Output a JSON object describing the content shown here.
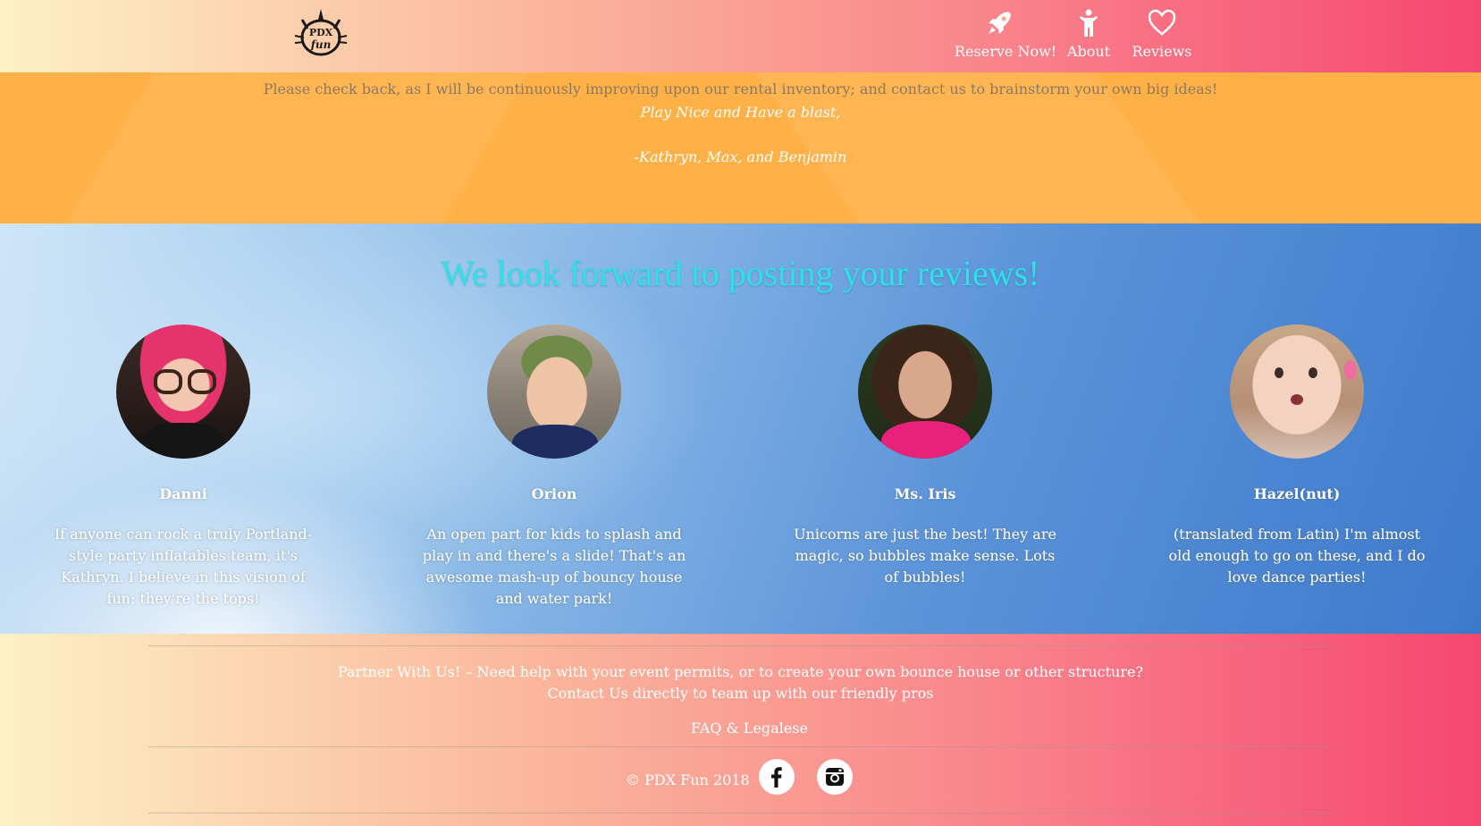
{
  "header": {
    "logo_text": "PDX Fun",
    "nav": [
      {
        "label": "Reserve Now!",
        "icon": "rocket-icon"
      },
      {
        "label": "About",
        "icon": "person-icon"
      },
      {
        "label": "Reviews",
        "icon": "heart-icon"
      }
    ]
  },
  "message": {
    "main": "Please check back, as I will be continuously improving upon our rental inventory; and contact us to brainstorm your own big ideas!",
    "sign_off": "Play Nice and Have a blast,",
    "names": "-Kathryn, Max, and Benjamin"
  },
  "reviews": {
    "title": "We look forward to posting your reviews!",
    "items": [
      {
        "name": "Danni",
        "text": "If anyone can rock a truly Portland-style party inflatables team, it's Kathryn. I believe in this vision of fun; they're the tops!"
      },
      {
        "name": "Orion",
        "text": "An open part for kids to splash and play in and there's a slide! That's an awesome mash-up of bouncy house and water park!"
      },
      {
        "name": "Ms. Iris",
        "text": "Unicorns are just the best! They are magic, so bubbles make sense. Lots of bubbles!"
      },
      {
        "name": "Hazel(nut)",
        "text": "(translated from Latin) I'm almost old enough to go on these, and I do love dance parties!"
      }
    ]
  },
  "footer": {
    "partner_line1": "Partner With Us! – Need help with your event permits, or to create your own bounce house or other structure?",
    "partner_line2": "Contact Us directly to team up with our friendly pros",
    "faq_link": "FAQ & Legalese",
    "copyright": "© PDX Fun 2018",
    "social": [
      {
        "icon": "facebook-icon"
      },
      {
        "icon": "instagram-icon"
      }
    ]
  },
  "colors": {
    "header_gradient_start": "#fdf1c4",
    "header_gradient_end": "#f6476f",
    "band": "#ffb147",
    "reviews_title": "#2fe0e6"
  }
}
